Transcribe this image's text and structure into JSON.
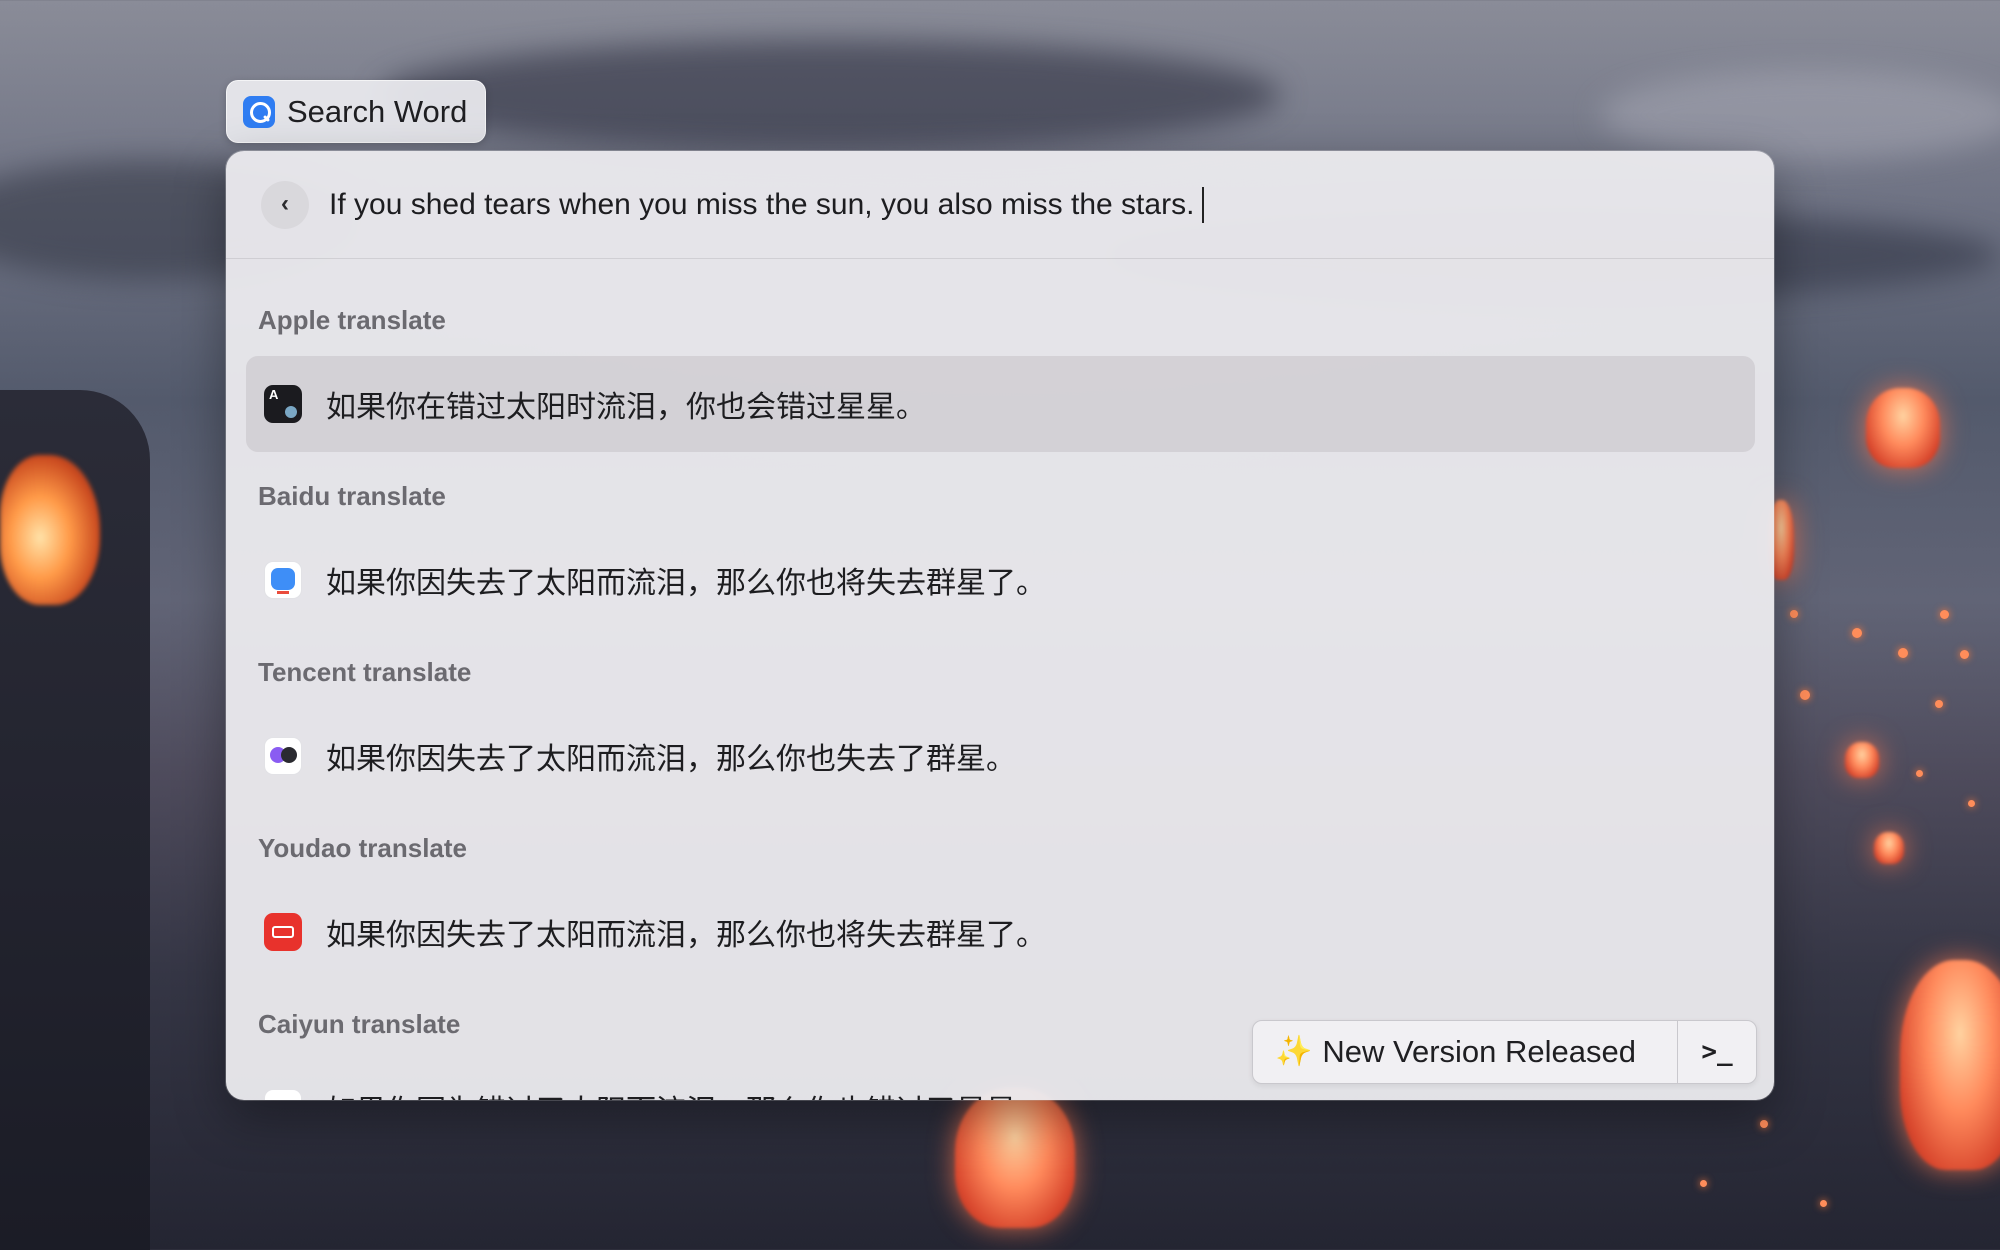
{
  "tab": {
    "label": "Search Word",
    "icon": "search-word-icon"
  },
  "search": {
    "query": "If you shed tears when you miss the sun, you also miss the stars."
  },
  "results": [
    {
      "service": "Apple translate",
      "translation": "如果你在错过太阳时流泪，你也会错过星星。",
      "icon": "apple-translate-icon"
    },
    {
      "service": "Baidu translate",
      "translation": "如果你因失去了太阳而流泪，那么你也将失去群星了。",
      "icon": "baidu-translate-icon"
    },
    {
      "service": "Tencent translate",
      "translation": "如果你因失去了太阳而流泪，那么你也失去了群星。",
      "icon": "tencent-translate-icon"
    },
    {
      "service": "Youdao translate",
      "translation": "如果你因失去了太阳而流泪，那么你也将失去群星了。",
      "icon": "youdao-translate-icon"
    },
    {
      "service": "Caiyun translate",
      "translation": "如果你因为错过了太阳而流泪，那么你也错过了星星。",
      "icon": "caiyun-translate-icon"
    }
  ],
  "toast": {
    "label": "New Version Released",
    "terminal_label": ">_"
  }
}
